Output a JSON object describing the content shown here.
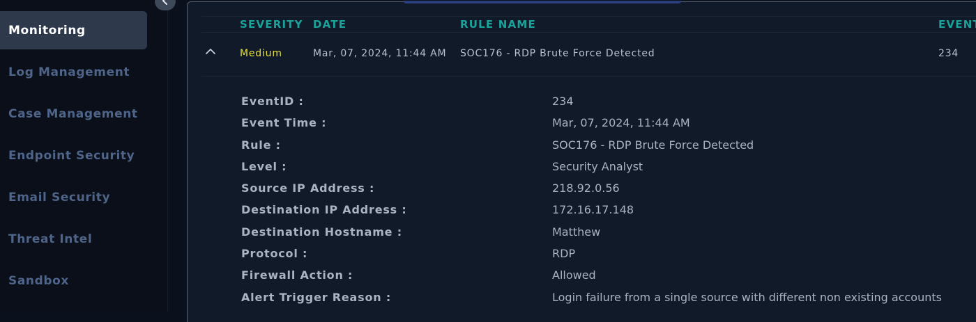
{
  "sidebar": {
    "collapse_icon": "chevron-left-icon",
    "items": [
      {
        "label": "Monitoring",
        "active": true
      },
      {
        "label": "Log Management"
      },
      {
        "label": "Case Management"
      },
      {
        "label": "Endpoint Security"
      },
      {
        "label": "Email Security"
      },
      {
        "label": "Threat Intel"
      },
      {
        "label": "Sandbox"
      }
    ]
  },
  "table": {
    "headers": {
      "severity": "SEVERITY",
      "date": "DATE",
      "rule_name": "RULE NAME",
      "event": "EVENT"
    },
    "row": {
      "severity": "Medium",
      "date": "Mar, 07, 2024, 11:44 AM",
      "rule_name": "SOC176 - RDP Brute Force Detected",
      "event_id": "234"
    }
  },
  "details": [
    {
      "label": "EventID :",
      "value": "234"
    },
    {
      "label": "Event Time :",
      "value": "Mar, 07, 2024, 11:44 AM"
    },
    {
      "label": "Rule :",
      "value": "SOC176 - RDP Brute Force Detected"
    },
    {
      "label": "Level :",
      "value": "Security Analyst"
    },
    {
      "label": "Source IP Address :",
      "value": "218.92.0.56"
    },
    {
      "label": "Destination IP Address :",
      "value": "172.16.17.148"
    },
    {
      "label": "Destination Hostname :",
      "value": "Matthew"
    },
    {
      "label": "Protocol :",
      "value": "RDP"
    },
    {
      "label": "Firewall Action :",
      "value": "Allowed"
    },
    {
      "label": "Alert Trigger Reason :",
      "value": "Login failure from a single source with different non existing accounts"
    }
  ],
  "colors": {
    "accent_teal": "#1aa39a",
    "severity_medium": "#e8e03a",
    "active_nav": "#2e3a4c"
  }
}
